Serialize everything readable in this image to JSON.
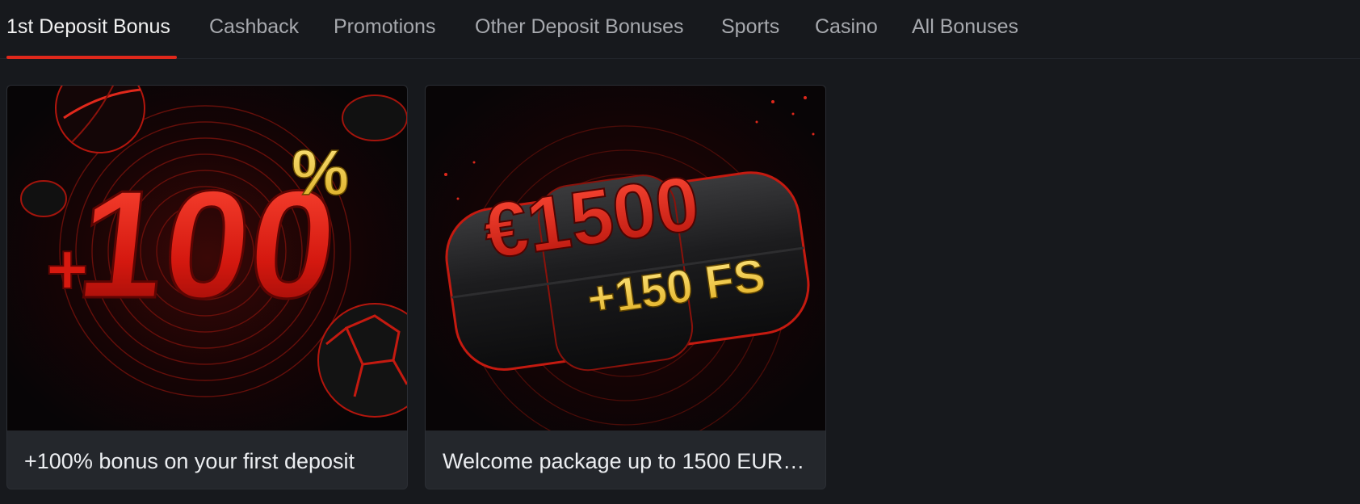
{
  "tabs": [
    {
      "label": "1st Deposit Bonus",
      "active": true
    },
    {
      "label": "Cashback",
      "active": false
    },
    {
      "label": "Promotions",
      "active": false
    },
    {
      "label": "Other Deposit Bonuses",
      "active": false
    },
    {
      "label": "Sports",
      "active": false
    },
    {
      "label": "Casino",
      "active": false
    },
    {
      "label": "All Bonuses",
      "active": false
    }
  ],
  "cards": [
    {
      "caption": "+100% bonus on your first deposit",
      "art_text": {
        "plus": "+",
        "amount": "100",
        "percent": "%"
      }
    },
    {
      "caption": "Welcome package up to 1500 EUR …",
      "art_text": {
        "amount": "€1500",
        "extra": "+150 FS"
      }
    }
  ],
  "colors": {
    "background": "#17191d",
    "card": "#24272c",
    "accent_red": "#e0281b",
    "gold": "#f2c94c"
  }
}
